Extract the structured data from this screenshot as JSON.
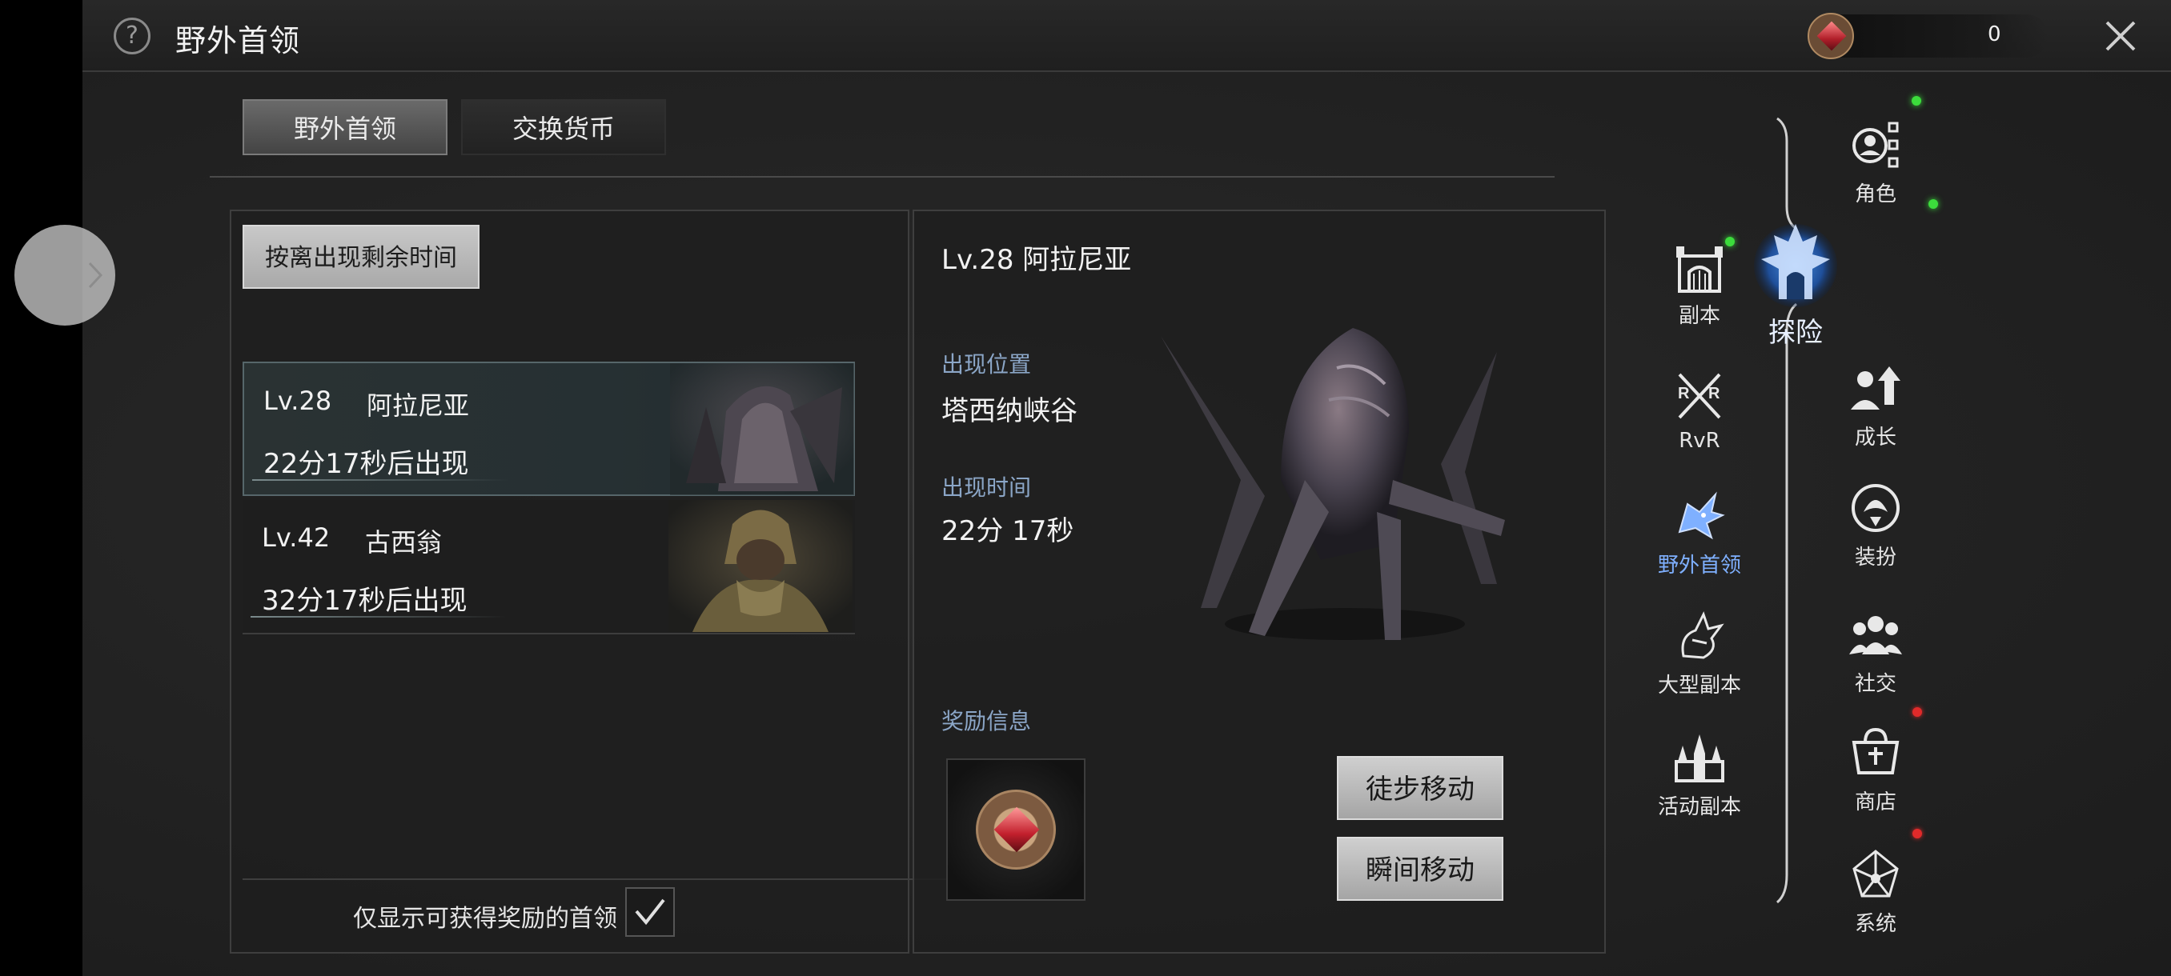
{
  "header": {
    "title": "野外首领",
    "currency_value": "0"
  },
  "tabs": [
    {
      "label": "野外首领",
      "active": true
    },
    {
      "label": "交换货币",
      "active": false
    }
  ],
  "list": {
    "sort_label": "按离出现剩余时间",
    "bosses": [
      {
        "level": "Lv.28",
        "name": "阿拉尼亚",
        "spawn_text": "22分17秒后出现",
        "selected": true
      },
      {
        "level": "Lv.42",
        "name": "古西翁",
        "spawn_text": "32分17秒后出现",
        "selected": false
      }
    ],
    "filter_label": "仅显示可获得奖励的首领",
    "filter_checked": true
  },
  "detail": {
    "title": "Lv.28 阿拉尼亚",
    "location_label": "出现位置",
    "location_value": "塔西纳峡谷",
    "time_label": "出现时间",
    "time_value": "22分 17秒",
    "reward_label": "奖励信息",
    "walk_button": "徒步移动",
    "teleport_button": "瞬间移动"
  },
  "nav_inner": [
    {
      "label": "副本",
      "icon": "castle-gate-icon",
      "badge": "green"
    },
    {
      "label": "RvR",
      "icon": "crossed-swords-icon",
      "badge": null
    },
    {
      "label": "野外首领",
      "icon": "dragon-head-icon",
      "badge": null,
      "active": true
    },
    {
      "label": "大型副本",
      "icon": "dragon-icon",
      "badge": null
    },
    {
      "label": "活动副本",
      "icon": "spires-icon",
      "badge": null
    }
  ],
  "nav_outer": [
    {
      "label": "角色",
      "icon": "character-tree-icon",
      "badge": "green"
    },
    {
      "label": "探险",
      "icon": "explore-emblem-icon",
      "badge": "green",
      "active": true
    },
    {
      "label": "成长",
      "icon": "growth-icon",
      "badge": null
    },
    {
      "label": "装扮",
      "icon": "costume-icon",
      "badge": null
    },
    {
      "label": "社交",
      "icon": "social-icon",
      "badge": null
    },
    {
      "label": "商店",
      "icon": "shop-icon",
      "badge": "red"
    },
    {
      "label": "系统",
      "icon": "system-network-icon",
      "badge": "red"
    }
  ],
  "colors": {
    "accent_blue": "#7fb0ff",
    "label_blue": "#8ba6c7",
    "badge_green": "#3cdc3c",
    "badge_red": "#e02a2a"
  }
}
